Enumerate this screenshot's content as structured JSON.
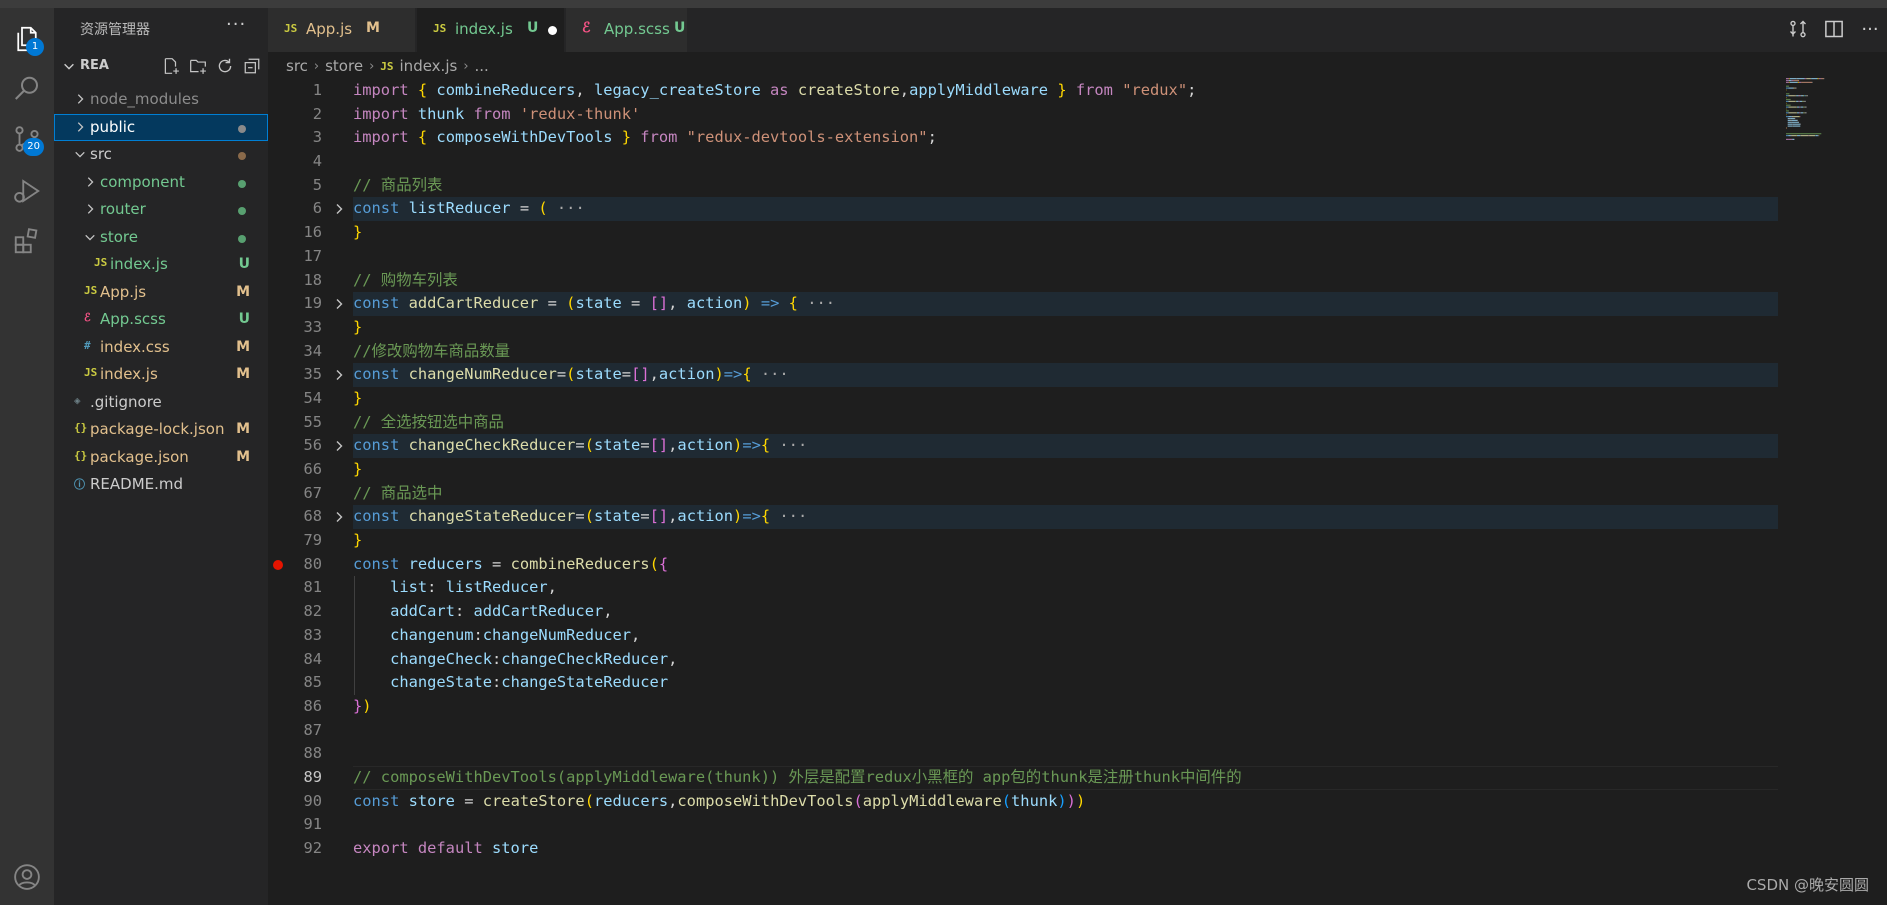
{
  "activity": {
    "explorer_badge": "1",
    "scm_badge": "20"
  },
  "sidebar": {
    "title": "资源管理器",
    "root": "REA",
    "tree": [
      {
        "name": "node_modules",
        "kind": "folder",
        "collapsed": true,
        "indent": 1,
        "color": "#8c8c8c"
      },
      {
        "name": "public",
        "kind": "folder",
        "collapsed": true,
        "indent": 1,
        "color": "#ffffff",
        "status_dot": "#8a8a8a",
        "selected": true
      },
      {
        "name": "src",
        "kind": "folder",
        "collapsed": false,
        "indent": 1,
        "color": "#cccccc",
        "status_dot": "#8a6a4a"
      },
      {
        "name": "component",
        "kind": "folder",
        "collapsed": true,
        "indent": 2,
        "color": "#73c991",
        "status_dot": "#58a070"
      },
      {
        "name": "router",
        "kind": "folder",
        "collapsed": true,
        "indent": 2,
        "color": "#73c991",
        "status_dot": "#58a070"
      },
      {
        "name": "store",
        "kind": "folder",
        "collapsed": false,
        "indent": 2,
        "color": "#73c991",
        "status_dot": "#58a070"
      },
      {
        "name": "index.js",
        "kind": "js",
        "indent": 3,
        "color": "#73c991",
        "status": "U",
        "status_color": "#73c991"
      },
      {
        "name": "App.js",
        "kind": "js",
        "indent": 2,
        "color": "#e2c08d",
        "status": "M",
        "status_color": "#e2c08d"
      },
      {
        "name": "App.scss",
        "kind": "scss",
        "indent": 2,
        "color": "#73c991",
        "status": "U",
        "status_color": "#73c991"
      },
      {
        "name": "index.css",
        "kind": "css",
        "indent": 2,
        "color": "#e2c08d",
        "status": "M",
        "status_color": "#e2c08d"
      },
      {
        "name": "index.js",
        "kind": "js",
        "indent": 2,
        "color": "#e2c08d",
        "status": "M",
        "status_color": "#e2c08d"
      },
      {
        "name": ".gitignore",
        "kind": "git",
        "indent": 1,
        "color": "#cccccc"
      },
      {
        "name": "package-lock.json",
        "kind": "json",
        "indent": 1,
        "color": "#e2c08d",
        "status": "M",
        "status_color": "#e2c08d"
      },
      {
        "name": "package.json",
        "kind": "json",
        "indent": 1,
        "color": "#e2c08d",
        "status": "M",
        "status_color": "#e2c08d"
      },
      {
        "name": "README.md",
        "kind": "info",
        "indent": 1,
        "color": "#cccccc"
      }
    ]
  },
  "tabs": [
    {
      "icon": "JS",
      "name": "App.js",
      "status": "M",
      "color": "#e2c08d",
      "active": false
    },
    {
      "icon": "JS",
      "name": "index.js",
      "status": "U",
      "color": "#73c991",
      "active": true,
      "dirty": true
    },
    {
      "icon": "scss",
      "name": "App.scss",
      "status": "U",
      "color": "#73c991",
      "active": false
    }
  ],
  "breadcrumb": [
    "src",
    "store",
    "index.js",
    "..."
  ],
  "code": [
    {
      "n": "1",
      "t": [
        [
          "kc",
          "import "
        ],
        [
          "b1",
          "{ "
        ],
        [
          "vr",
          "combineReducers"
        ],
        [
          "op",
          ", "
        ],
        [
          "vr",
          "legacy_createStore"
        ],
        [
          "kc",
          " as "
        ],
        [
          "fn",
          "createStore"
        ],
        [
          "op",
          ","
        ],
        [
          "vr",
          "applyMiddleware"
        ],
        [
          "b1",
          " } "
        ],
        [
          "kc",
          "from "
        ],
        [
          "str",
          "\"redux\""
        ],
        [
          "op",
          ";"
        ]
      ]
    },
    {
      "n": "2",
      "t": [
        [
          "kc",
          "import "
        ],
        [
          "vr",
          "thunk "
        ],
        [
          "kc",
          "from "
        ],
        [
          "str",
          "'redux-thunk'"
        ]
      ]
    },
    {
      "n": "3",
      "t": [
        [
          "kc",
          "import "
        ],
        [
          "b1",
          "{ "
        ],
        [
          "vr",
          "composeWithDevTools"
        ],
        [
          "b1",
          " } "
        ],
        [
          "kc",
          "from "
        ],
        [
          "str",
          "\"redux-devtools-extension\""
        ],
        [
          "op",
          ";"
        ]
      ]
    },
    {
      "n": "4",
      "t": []
    },
    {
      "n": "5",
      "t": [
        [
          "cm",
          "// 商品列表"
        ]
      ]
    },
    {
      "n": "6",
      "fold": true,
      "t": [
        [
          "kw",
          "const "
        ],
        [
          "vr",
          "listReducer"
        ],
        [
          "op",
          " = "
        ],
        [
          "b1",
          "("
        ],
        [
          "ell",
          " ···"
        ]
      ]
    },
    {
      "n": "16",
      "t": [
        [
          "b1",
          "}"
        ]
      ]
    },
    {
      "n": "17",
      "t": []
    },
    {
      "n": "18",
      "t": [
        [
          "cm",
          "// 购物车列表"
        ]
      ]
    },
    {
      "n": "19",
      "fold": true,
      "t": [
        [
          "kw",
          "const "
        ],
        [
          "fn",
          "addCartReducer"
        ],
        [
          "op",
          " = "
        ],
        [
          "b1",
          "("
        ],
        [
          "vr",
          "state"
        ],
        [
          "op",
          " = "
        ],
        [
          "b2",
          "[]"
        ],
        [
          "op",
          ", "
        ],
        [
          "vr",
          "action"
        ],
        [
          "b1",
          ")"
        ],
        [
          "kw",
          " => "
        ],
        [
          "b1",
          "{"
        ],
        [
          "ell",
          " ···"
        ]
      ]
    },
    {
      "n": "33",
      "t": [
        [
          "b1",
          "}"
        ]
      ]
    },
    {
      "n": "34",
      "t": [
        [
          "cm",
          "//修改购物车商品数量"
        ]
      ]
    },
    {
      "n": "35",
      "fold": true,
      "t": [
        [
          "kw",
          "const "
        ],
        [
          "fn",
          "changeNumReducer"
        ],
        [
          "op",
          "="
        ],
        [
          "b1",
          "("
        ],
        [
          "vr",
          "state"
        ],
        [
          "op",
          "="
        ],
        [
          "b2",
          "[]"
        ],
        [
          "op",
          ","
        ],
        [
          "vr",
          "action"
        ],
        [
          "b1",
          ")"
        ],
        [
          "kw",
          "=>"
        ],
        [
          "b1",
          "{"
        ],
        [
          "ell",
          " ···"
        ]
      ]
    },
    {
      "n": "54",
      "t": [
        [
          "b1",
          "}"
        ]
      ]
    },
    {
      "n": "55",
      "t": [
        [
          "cm",
          "// 全选按钮选中商品"
        ]
      ]
    },
    {
      "n": "56",
      "fold": true,
      "t": [
        [
          "kw",
          "const "
        ],
        [
          "fn",
          "changeCheckReducer"
        ],
        [
          "op",
          "="
        ],
        [
          "b1",
          "("
        ],
        [
          "vr",
          "state"
        ],
        [
          "op",
          "="
        ],
        [
          "b2",
          "[]"
        ],
        [
          "op",
          ","
        ],
        [
          "vr",
          "action"
        ],
        [
          "b1",
          ")"
        ],
        [
          "kw",
          "=>"
        ],
        [
          "b1",
          "{"
        ],
        [
          "ell",
          " ···"
        ]
      ]
    },
    {
      "n": "66",
      "t": [
        [
          "b1",
          "}"
        ]
      ]
    },
    {
      "n": "67",
      "t": [
        [
          "cm",
          "// 商品选中"
        ]
      ]
    },
    {
      "n": "68",
      "fold": true,
      "t": [
        [
          "kw",
          "const "
        ],
        [
          "fn",
          "changeStateReducer"
        ],
        [
          "op",
          "="
        ],
        [
          "b1",
          "("
        ],
        [
          "vr",
          "state"
        ],
        [
          "op",
          "="
        ],
        [
          "b2",
          "[]"
        ],
        [
          "op",
          ","
        ],
        [
          "vr",
          "action"
        ],
        [
          "b1",
          ")"
        ],
        [
          "kw",
          "=>"
        ],
        [
          "b1",
          "{"
        ],
        [
          "ell",
          " ···"
        ]
      ]
    },
    {
      "n": "79",
      "t": [
        [
          "b1",
          "}"
        ]
      ]
    },
    {
      "n": "80",
      "bp": true,
      "t": [
        [
          "kw",
          "const "
        ],
        [
          "vr",
          "reducers"
        ],
        [
          "op",
          " = "
        ],
        [
          "fn",
          "combineReducers"
        ],
        [
          "b1",
          "("
        ],
        [
          "b2",
          "{"
        ]
      ]
    },
    {
      "n": "81",
      "guide": true,
      "t": [
        [
          "op",
          "    "
        ],
        [
          "vr",
          "list"
        ],
        [
          "op",
          ": "
        ],
        [
          "vr",
          "listReducer"
        ],
        [
          "op",
          ","
        ]
      ]
    },
    {
      "n": "82",
      "guide": true,
      "t": [
        [
          "op",
          "    "
        ],
        [
          "vr",
          "addCart"
        ],
        [
          "op",
          ": "
        ],
        [
          "vr",
          "addCartReducer"
        ],
        [
          "op",
          ","
        ]
      ]
    },
    {
      "n": "83",
      "guide": true,
      "t": [
        [
          "op",
          "    "
        ],
        [
          "vr",
          "changenum"
        ],
        [
          "op",
          ":"
        ],
        [
          "vr",
          "changeNumReducer"
        ],
        [
          "op",
          ","
        ]
      ]
    },
    {
      "n": "84",
      "guide": true,
      "t": [
        [
          "op",
          "    "
        ],
        [
          "vr",
          "changeCheck"
        ],
        [
          "op",
          ":"
        ],
        [
          "vr",
          "changeCheckReducer"
        ],
        [
          "op",
          ","
        ]
      ]
    },
    {
      "n": "85",
      "guide": true,
      "t": [
        [
          "op",
          "    "
        ],
        [
          "vr",
          "changeState"
        ],
        [
          "op",
          ":"
        ],
        [
          "vr",
          "changeStateReducer"
        ]
      ]
    },
    {
      "n": "86",
      "t": [
        [
          "b2",
          "}"
        ],
        [
          "b1",
          ")"
        ]
      ]
    },
    {
      "n": "87",
      "t": []
    },
    {
      "n": "88",
      "t": []
    },
    {
      "n": "89",
      "current": true,
      "t": [
        [
          "cm",
          "// composeWithDevTools(applyMiddleware(thunk)) 外层是配置redux小黑框的 app包的thunk是注册thunk中间件的"
        ]
      ]
    },
    {
      "n": "90",
      "t": [
        [
          "kw",
          "const "
        ],
        [
          "vr",
          "store"
        ],
        [
          "op",
          " = "
        ],
        [
          "fn",
          "createStore"
        ],
        [
          "b1",
          "("
        ],
        [
          "vr",
          "reducers"
        ],
        [
          "op",
          ","
        ],
        [
          "fn",
          "composeWithDevTools"
        ],
        [
          "b2",
          "("
        ],
        [
          "fn",
          "applyMiddleware"
        ],
        [
          "b3",
          "("
        ],
        [
          "vr",
          "thunk"
        ],
        [
          "b3",
          ")"
        ],
        [
          "b2",
          ")"
        ],
        [
          "b1",
          ")"
        ]
      ]
    },
    {
      "n": "91",
      "t": []
    },
    {
      "n": "92",
      "t": [
        [
          "kc",
          "export "
        ],
        [
          "kc",
          "default "
        ],
        [
          "vr",
          "store"
        ]
      ]
    }
  ],
  "watermark": "CSDN @晚安圆圆"
}
